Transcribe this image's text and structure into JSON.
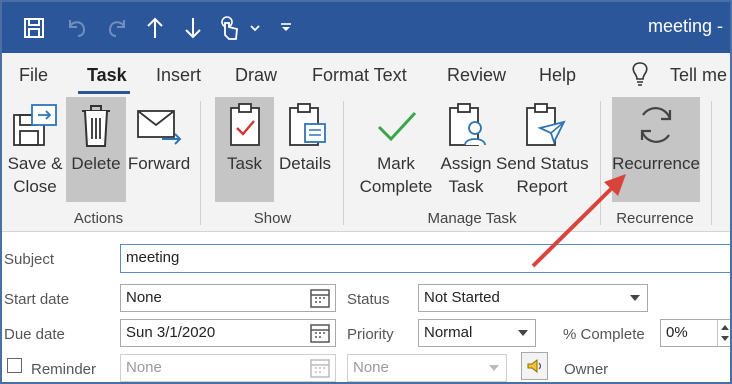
{
  "window": {
    "title": "meeting -"
  },
  "quick_access": {
    "icons": [
      "save-icon",
      "undo-icon",
      "redo-icon",
      "up-arrow-icon",
      "down-arrow-icon",
      "touch-mode-icon",
      "chevron-down-icon",
      "customize-icon"
    ]
  },
  "tabs": [
    {
      "label": "File",
      "active": false
    },
    {
      "label": "Task",
      "active": true
    },
    {
      "label": "Insert",
      "active": false
    },
    {
      "label": "Draw",
      "active": false
    },
    {
      "label": "Format Text",
      "active": false
    },
    {
      "label": "Review",
      "active": false
    },
    {
      "label": "Help",
      "active": false
    }
  ],
  "tell_me": "Tell me",
  "ribbon": {
    "groups": [
      {
        "label": "Actions",
        "buttons": [
          {
            "line1": "Save &",
            "line2": "Close",
            "icon": "save-close-icon"
          },
          {
            "line1": "Delete",
            "line2": "",
            "icon": "trash-icon",
            "pressed": true
          },
          {
            "line1": "Forward",
            "line2": "",
            "icon": "forward-mail-icon"
          }
        ]
      },
      {
        "label": "Show",
        "buttons": [
          {
            "line1": "Task",
            "line2": "",
            "icon": "task-clipboard-icon",
            "pressed": true
          },
          {
            "line1": "Details",
            "line2": "",
            "icon": "details-clipboard-icon"
          }
        ]
      },
      {
        "label": "Manage Task",
        "buttons": [
          {
            "line1": "Mark",
            "line2": "Complete",
            "icon": "checkmark-icon"
          },
          {
            "line1": "Assign",
            "line2": "Task",
            "icon": "assign-task-icon"
          },
          {
            "line1": "Send Status",
            "line2": "Report",
            "icon": "send-report-icon"
          }
        ]
      },
      {
        "label": "Recurrence",
        "buttons": [
          {
            "line1": "Recurrence",
            "line2": "",
            "icon": "recurrence-icon",
            "pressed": true
          }
        ]
      }
    ]
  },
  "form": {
    "subject_label": "Subject",
    "subject_value": "meeting",
    "start_date_label": "Start date",
    "start_date_value": "None",
    "due_date_label": "Due date",
    "due_date_value": "Sun 3/1/2020",
    "status_label": "Status",
    "status_value": "Not Started",
    "priority_label": "Priority",
    "priority_value": "Normal",
    "percent_label": "% Complete",
    "percent_value": "0%",
    "reminder_label": "Reminder",
    "reminder_checked": false,
    "reminder_date_value": "None",
    "reminder_time_value": "None",
    "owner_label": "Owner"
  },
  "colors": {
    "titlebar": "#2b579a",
    "ribbon_bg": "#f3f3f3",
    "pressed_bg": "#c5c5c5",
    "annotation_arrow": "#d9443a"
  }
}
